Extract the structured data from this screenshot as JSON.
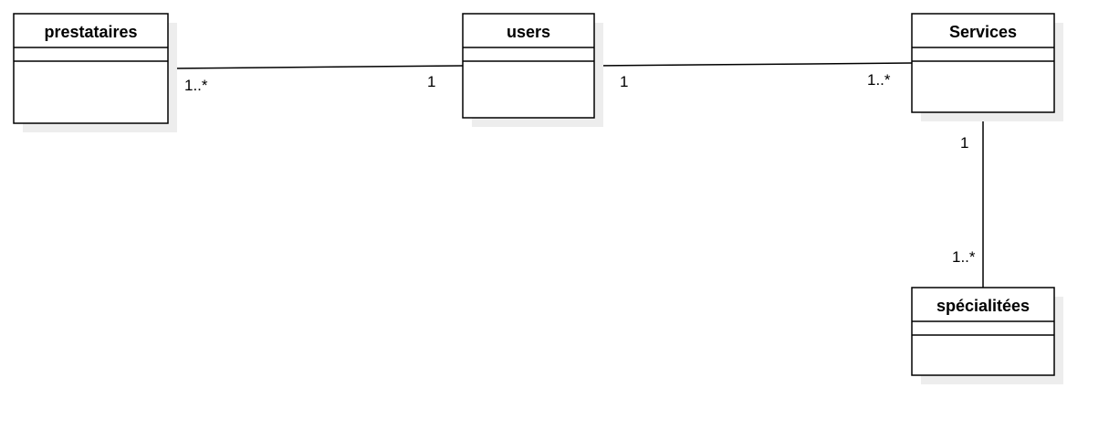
{
  "colors": {
    "stroke": "#000000",
    "fill": "#ffffff",
    "shadow": "#ededed"
  },
  "classes": {
    "prestataires": {
      "name": "prestataires"
    },
    "users": {
      "name": "users"
    },
    "services": {
      "name": "Services"
    },
    "specialites": {
      "name": "spécialitées"
    }
  },
  "associations": {
    "prestataires_users": {
      "source_multiplicity": "1..*",
      "target_multiplicity": "1"
    },
    "users_services": {
      "source_multiplicity": "1",
      "target_multiplicity": "1..*"
    },
    "services_specialites": {
      "source_multiplicity": "1",
      "target_multiplicity": "1..*"
    }
  }
}
